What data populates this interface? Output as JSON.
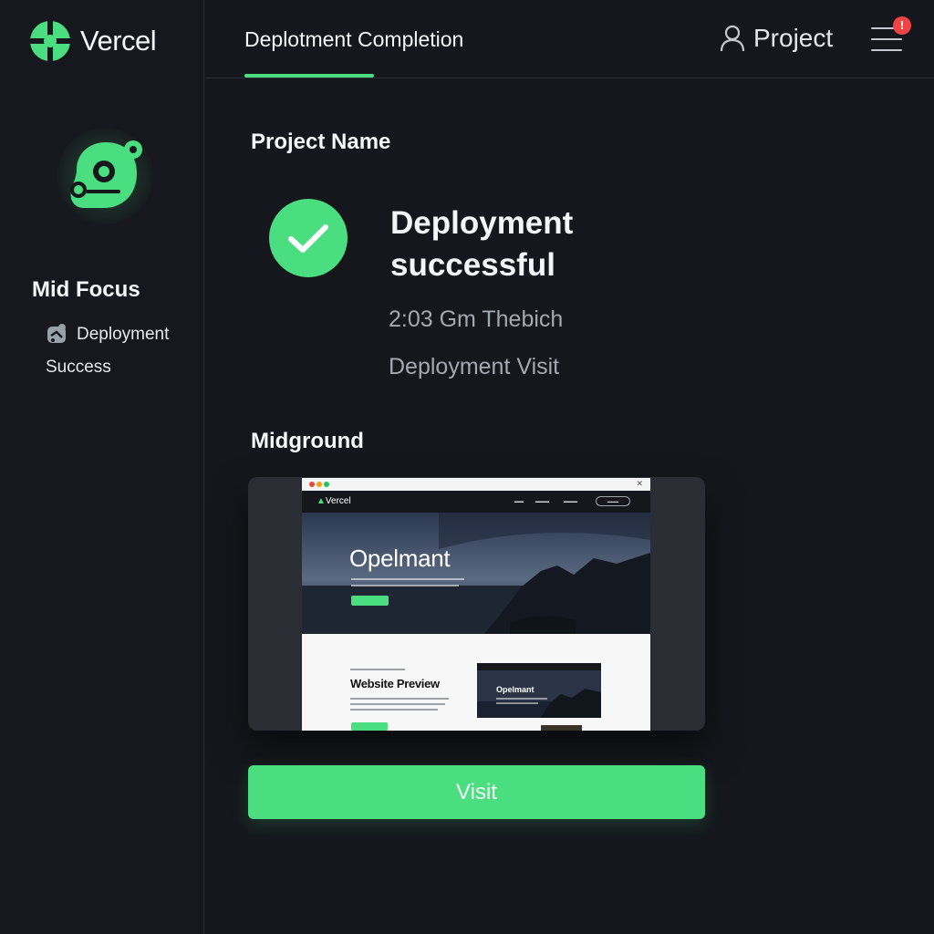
{
  "app": {
    "name": "Vercel"
  },
  "colors": {
    "accent": "#4ade80",
    "background": "#15171c",
    "alert": "#ef4444"
  },
  "sidebar": {
    "heading": "Mid Focus",
    "item": {
      "icon": "puzzle-icon",
      "line1": "Deployment",
      "line2": "Success"
    }
  },
  "header": {
    "tab_title": "Deplotment Completion",
    "project_label": "Project",
    "notification_badge": "!"
  },
  "main": {
    "project_name_label": "Project Name",
    "status": {
      "icon": "check-circle-icon",
      "title": "Deployment successful",
      "time": "2:03 Gm Thebich",
      "visit_text": "Deployment Visit"
    },
    "midground_label": "Midground",
    "preview": {
      "site_logo": "Vercel",
      "hero_title": "Opelmant",
      "section_title": "Website Preview",
      "mini_card_title": "Opelmant"
    },
    "visit_button": "Visit"
  }
}
